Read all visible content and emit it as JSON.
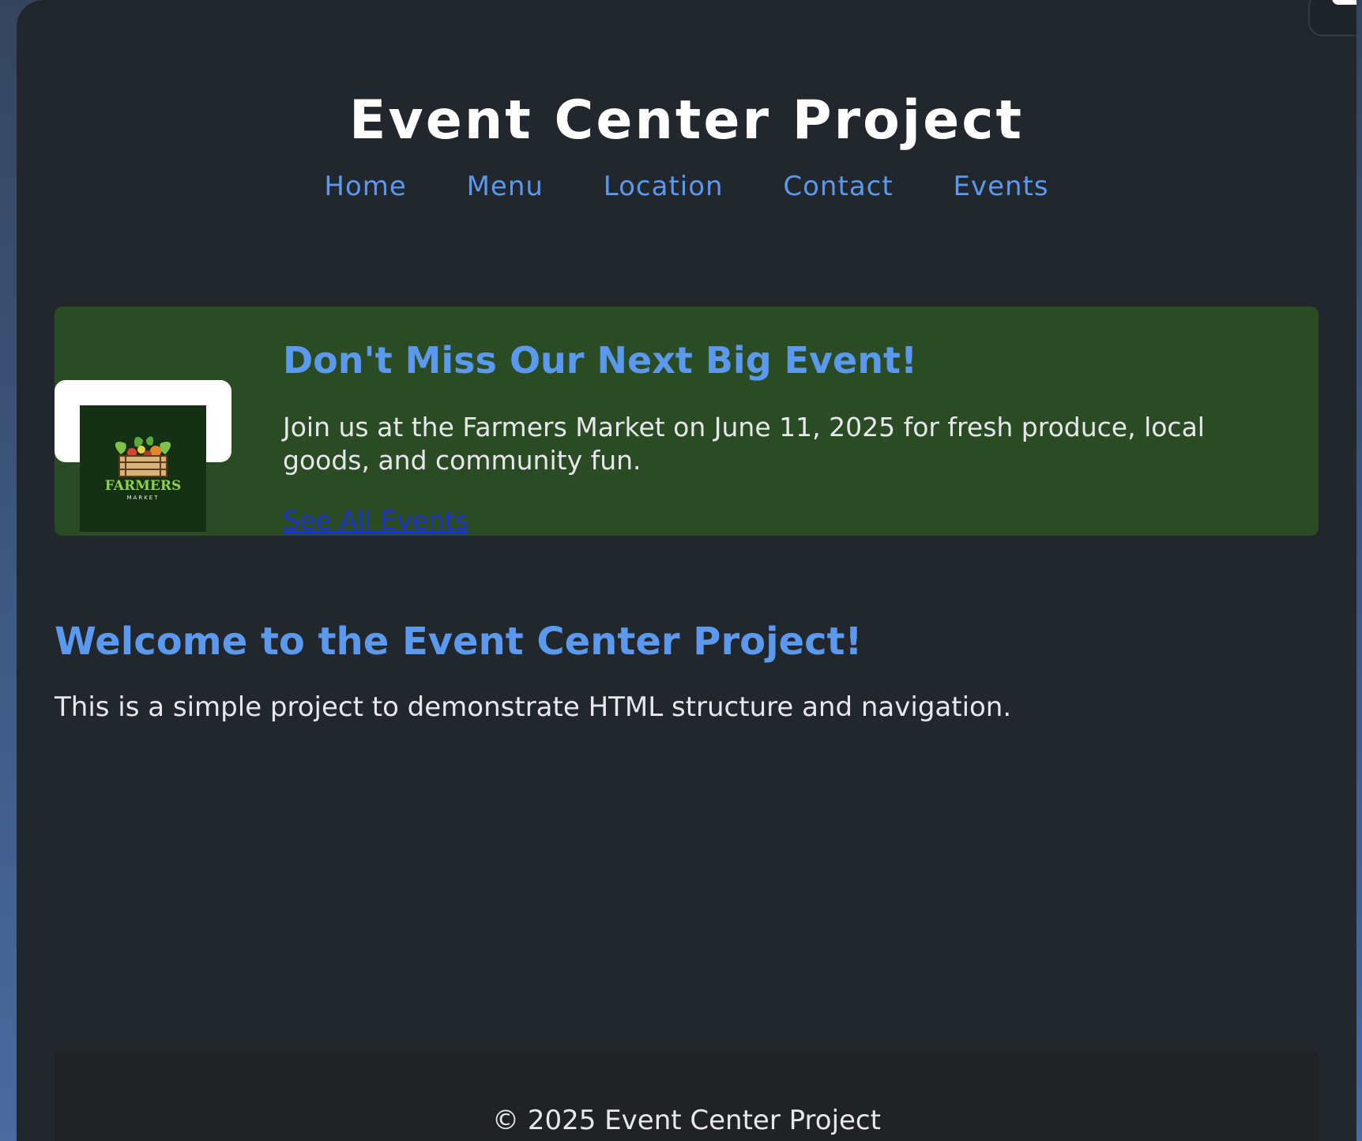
{
  "header": {
    "title": "Event Center Project",
    "nav": [
      "Home",
      "Menu",
      "Location",
      "Contact",
      "Events"
    ]
  },
  "promo": {
    "heading": "Don't Miss Our Next Big Event!",
    "text": "Join us at the Farmers Market on June 11, 2025 for fresh produce, local goods, and community fun.",
    "link_label": "See All Events",
    "logo_text": "FARMERS",
    "logo_subtext": "MARKET"
  },
  "main": {
    "heading": "Welcome to the Event Center Project!",
    "text": "This is a simple project to demonstrate HTML structure and navigation."
  },
  "footer": {
    "text": "© 2025 Event Center Project"
  },
  "colors": {
    "background": "#22262d",
    "accent": "#5b99ee",
    "promo_background": "#2b4b24",
    "link": "#1a35c8",
    "footer_background": "#212225"
  }
}
